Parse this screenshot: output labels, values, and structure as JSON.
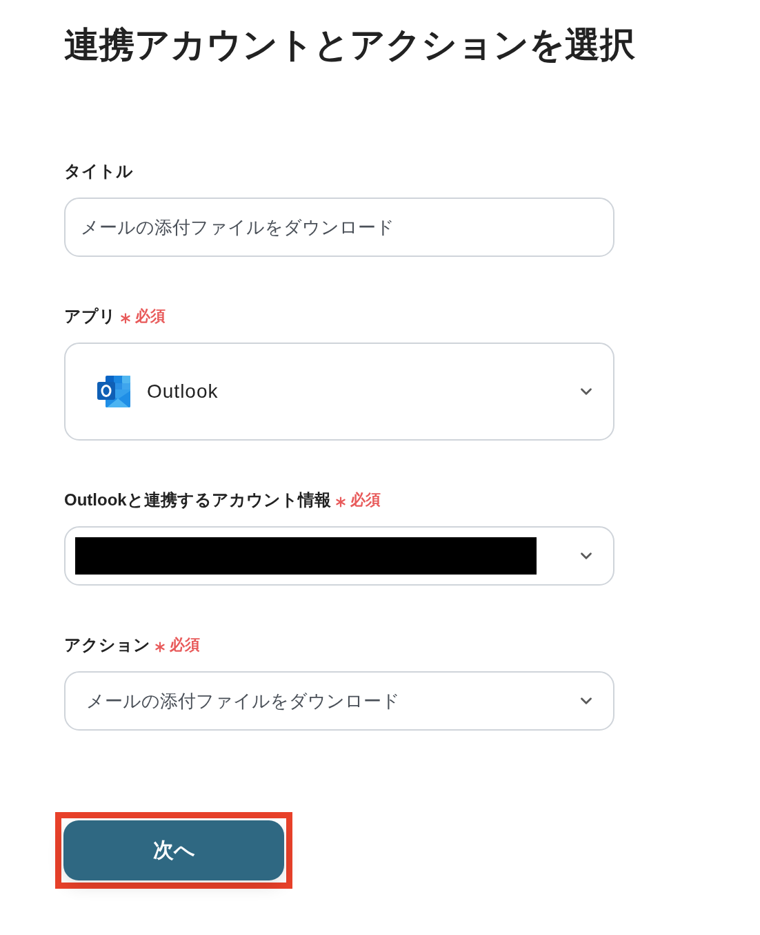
{
  "heading": "連携アカウントとアクションを選択",
  "fields": [
    {
      "kind": "text",
      "label": "タイトル",
      "required": false,
      "value": "メールの添付ファイルをダウンロード"
    },
    {
      "kind": "app-select",
      "label": "アプリ",
      "required": true,
      "required_label": "必須",
      "value": "Outlook"
    },
    {
      "kind": "redacted-select",
      "label": "Outlookと連携するアカウント情報",
      "required": true,
      "required_label": "必須"
    },
    {
      "kind": "select",
      "label": "アクション",
      "required": true,
      "required_label": "必須",
      "value": "メールの添付ファイルをダウンロード"
    }
  ],
  "next_button": {
    "label": "次へ",
    "highlighted": true
  }
}
